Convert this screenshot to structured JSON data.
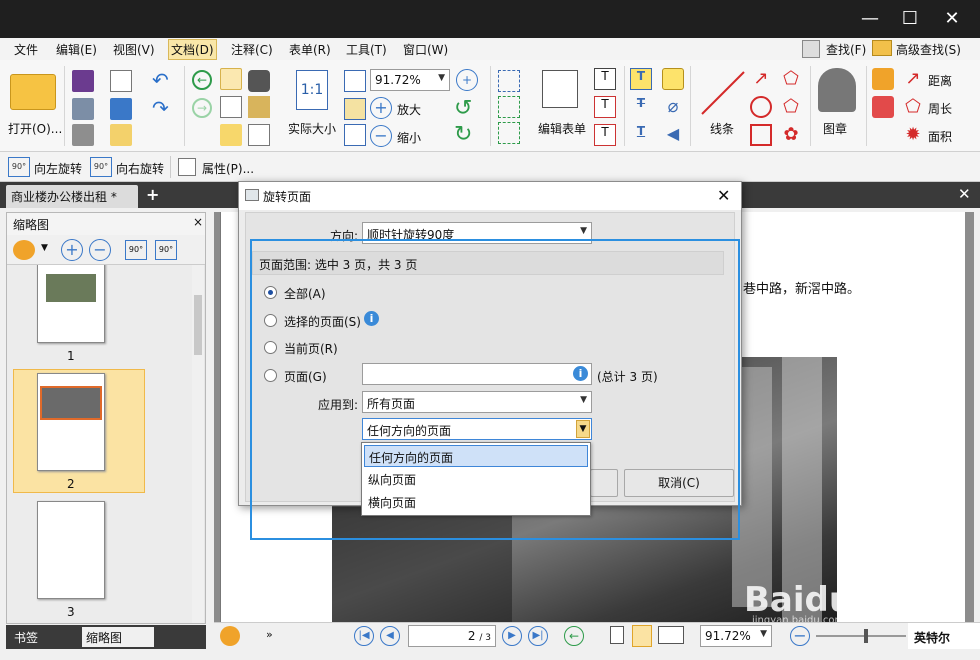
{
  "menu": [
    "文件",
    "编辑(E)",
    "视图(V)",
    "文档(D)",
    "注释(C)",
    "表单(R)",
    "工具(T)",
    "窗口(W)"
  ],
  "menu_right": {
    "find": "查找(F)",
    "adv_find": "高级查找(S)"
  },
  "ribbon": {
    "open": "打开(O)...",
    "zoom_value": "91.72%",
    "actual_size": "实际大小",
    "zoom_in": "放大",
    "zoom_out": "缩小",
    "edit_form": "编辑表单",
    "line": "线条",
    "stamp": "图章",
    "distance": "距离",
    "perimeter": "周长",
    "area": "面积"
  },
  "rotbar": {
    "rotate_left": "向左旋转",
    "rotate_right": "向右旋转",
    "properties": "属性(P)..."
  },
  "tab": {
    "doc_title": "商业楼办公楼出租 *"
  },
  "left_panel": {
    "title": "缩略图",
    "pages": [
      "1",
      "2",
      "3"
    ],
    "bottom_tabs": [
      "书签",
      "缩略图"
    ]
  },
  "doc_text": "巷中路，新滘中路。",
  "dialog": {
    "title": "旋转页面",
    "direction_label": "方向:",
    "direction_value": "顺时针旋转90度",
    "range_header": "页面范围: 选中 3 页，共 3 页",
    "opt_all": "全部(A)",
    "opt_selected": "选择的页面(S)",
    "opt_current": "当前页(R)",
    "opt_pages": "页面(G)",
    "total": "(总计 3 页)",
    "apply_label": "应用到:",
    "apply_value": "所有页面",
    "orient_value": "任何方向的页面",
    "cancel": "取消(C)"
  },
  "dropdown": [
    "任何方向的页面",
    "纵向页面",
    "横向页面"
  ],
  "status": {
    "page": "2",
    "total": "/ 3",
    "zoom": "91.72%"
  },
  "watermark": "Baidu经验",
  "watermark_url": "jingyan.baidu.com",
  "taskbar_text": "英特尔",
  "colors": {
    "highlight": "#2b8fe0",
    "accent": "#f0a32a"
  }
}
